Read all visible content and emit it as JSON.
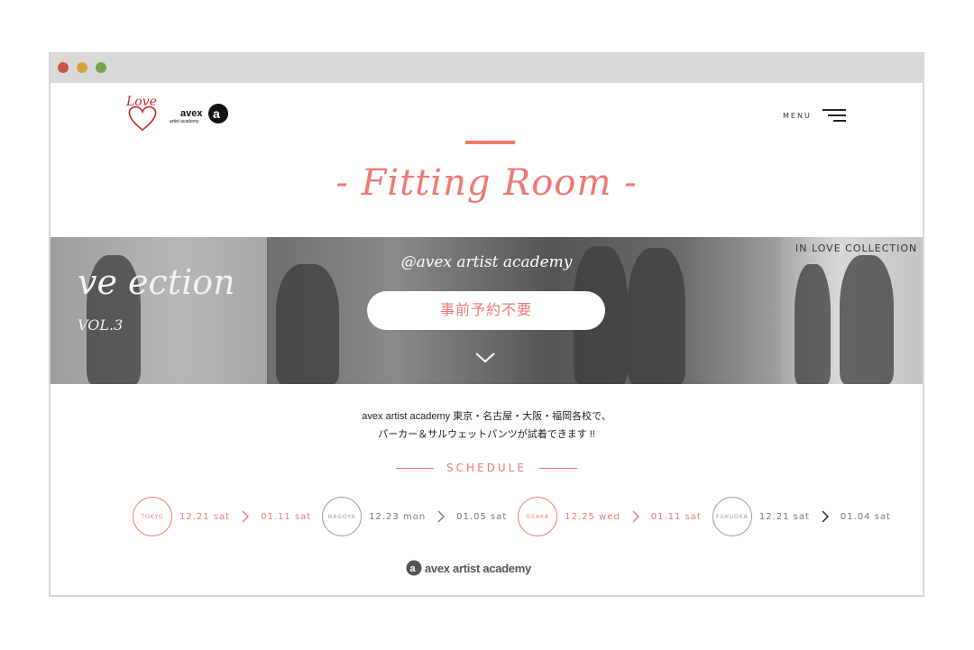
{
  "header": {
    "love_logo_text": "Love",
    "avex_logo_text": "avex",
    "avex_logo_sub": "artist academy",
    "menu_label": "MENU"
  },
  "page_title": "- Fitting Room -",
  "hero": {
    "subtitle": "@avex artist academy",
    "cta_label": "事前予約不要",
    "poster_left_text": "ve ection",
    "poster_left_vol": "VOL.3",
    "poster_right_text": "IN LOVE COLLECTION"
  },
  "description": {
    "line1": "avex artist academy 東京・名古屋・大阪・福岡各校で、",
    "line2": "パーカー＆サルウェットパンツが試着できます !!"
  },
  "schedule": {
    "heading": "SCHEDULE",
    "items": [
      {
        "city": "TOKYO",
        "start": "12.21 sat",
        "end": "01.11 sat",
        "highlight": true
      },
      {
        "city": "NAGOYA",
        "start": "12.23 mon",
        "end": "01.05 sat",
        "highlight": false
      },
      {
        "city": "OSAKA",
        "start": "12.25 wed",
        "end": "01.11 sat",
        "highlight": true
      },
      {
        "city": "FUKUOKA",
        "start": "12.21 sat",
        "end": "01.04 sat",
        "highlight": false
      }
    ]
  },
  "footer": {
    "logo_text": "avex artist academy"
  },
  "colors": {
    "accent": "#ef7a73",
    "muted": "#999999",
    "dark": "#222222"
  }
}
